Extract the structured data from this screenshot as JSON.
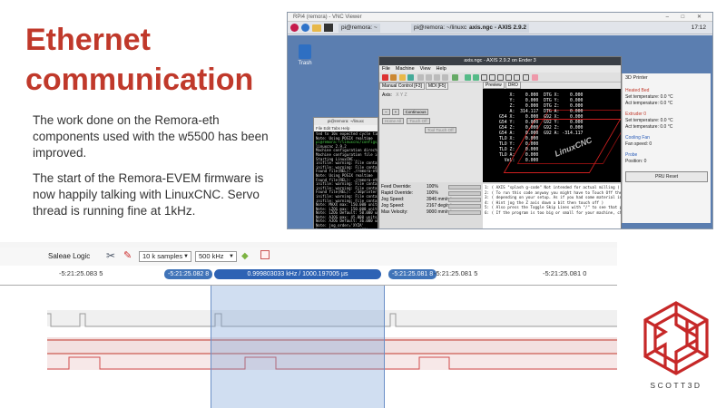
{
  "slide": {
    "title_line1": "Ethernet",
    "title_line2": "communication",
    "para1": "The work done on the Remora-eth components used with the w5500 has been improved.",
    "para2": "The start of the Remora-EVEM firmware is now happily talking with LinuxCNC. Servo thread is running fine at 1kHz.",
    "logo_text": "SCOTT3D"
  },
  "vnc": {
    "window_title": "RPi4 (remora) - VNC Viewer",
    "taskbar": {
      "pi_item": "pi@remora: ~",
      "term_item": "pi@remora: ~/linuxcn",
      "axis_item": "axis.ngc - AXIS 2.9.2",
      "clock": "17:12"
    },
    "desktop_trash_label": "Trash"
  },
  "terminal": {
    "title": "pi@remora: ~/linuxc",
    "menu": "File  Edit  Tabs  Help",
    "lines": [
      "ted to 10x expected cycle time of 0.0",
      "Note: Using POSIX realtime",
      "pi@remora:~/linuxcnc/configs/Remora",
      "linuxcnc 2.9.2",
      "Machine configuration directory is '/h",
      "Machine configuration file is 'remora",
      "Starting LinuxCNC...",
      "inifile: warning: File contains DOS-st",
      "inifile: warning: File contains DOS-st",
      "Found file(REL): ./remora-eth.hal",
      "Note: Using POSIX realtime",
      "Found file(REL): ./remora-eth.hal",
      "inifile: warning: File contains DOS-st",
      "inifile: warning: File contains DOS-st",
      "Found file(REL): ./3dprinter.hal",
      "inifile: warning: File contains DOS-st",
      "inifile: warning: File contains DOS-st",
      "Note: MAXX     max: 150.000 units/sec",
      "Note: LZOG     max: 150.000 units/sec",
      "Note: LZOG Default: 50.000 units/sec",
      "Note: AJOG     max: 45.000 units/sec",
      "Note: AJOG Default: 36.000 units/sec",
      "Note: jog_order='XYZA'",
      "Note: jog_invert=set([])"
    ]
  },
  "axis": {
    "title": "axis.ngc - AXIS 2.9.2 on Ender 3",
    "menu": [
      "File",
      "Machine",
      "View",
      "Help"
    ],
    "tab_manual": "Manual Control [F3]",
    "tab_mdi": "MDI [F5]",
    "axis_label": "Axis:",
    "axis_options": "X  Y  Z",
    "continuous": "Continuous",
    "btn_home": "Home All",
    "btn_touch": "Touch Off",
    "btn_tool": "Tool Touch Off",
    "preview_tab": "Preview",
    "dro_tab": "DRO",
    "dro_text": "    X:    0.000  DTG X:    0.000\n    Y:    0.000  DTG Y:    0.000\n    Z:    0.000  DTG Z:    0.000\n    A:  314.117  DTG A:    0.000\nG54 X:    0.000  G92 X:    0.000\nG54 Y:    0.000  G92 Y:    0.000\nG54 Z:    0.000  G92 Z:    0.000\nG54 A:    0.000  G92 A: -314.117\nTLO X:    0.000\nTLO Y:    0.000\nTLO Z:    0.000\nTLO A:    0.000\n  Vel:    0.000",
    "cnc_overlay": "LinuxCNC",
    "sliders": [
      {
        "label": "Feed Override:",
        "value": "100%"
      },
      {
        "label": "Rapid Override:",
        "value": "100%"
      },
      {
        "label": "Jog Speed:",
        "value": "3946 mm/min"
      },
      {
        "label": "Jog Speed:",
        "value": "2167 deg/min"
      },
      {
        "label": "Max Velocity:",
        "value": "9000 mm/min"
      }
    ],
    "gcode": [
      "1: ( AXIS \"splash g-code\" Not intended for actual milling )",
      "2: ( To run this code anyway you might have to Touch Off the Z axis)",
      "3: ( depending on your setup. As if you had some material in your mill... )",
      "4: ( Hint jog the Z axis down a bit then touch off )",
      "5: ( Also press the Toggle Skip Lines with \"/\" to see that part )",
      "6: ( If the program is too big or small for your machine, change the scale below )"
    ]
  },
  "printer": {
    "header": "3D Printer",
    "heated_bed": "Heated Bed",
    "set_temp_label": "Set temperature:",
    "set_temp": "0.0",
    "act_temp_label": "Act temperature:",
    "act_temp": "0.0",
    "unit": "°C",
    "extruder": "Extruder 0",
    "ex_set": "0.0",
    "ex_act": "0.0",
    "cooling": "Cooling Fan",
    "fan_label": "Fan speed:",
    "fan_speed": "0",
    "probe": "Probe",
    "position_label": "Position:",
    "position": "0",
    "reset_button": "PRU Reset"
  },
  "saleae": {
    "title": "Saleae Logic",
    "samples": "10 k samples",
    "rate": "500 kHz",
    "ticks": [
      "-5:21:25.083 5",
      "-5:21:25.081 5",
      "-5:21:25.081 0"
    ],
    "marker1": "-5:21:25.082 8",
    "marker2": "-5:21:25.081 8",
    "measurement": "0.999803033 kHz / 1000.197005 µs"
  }
}
